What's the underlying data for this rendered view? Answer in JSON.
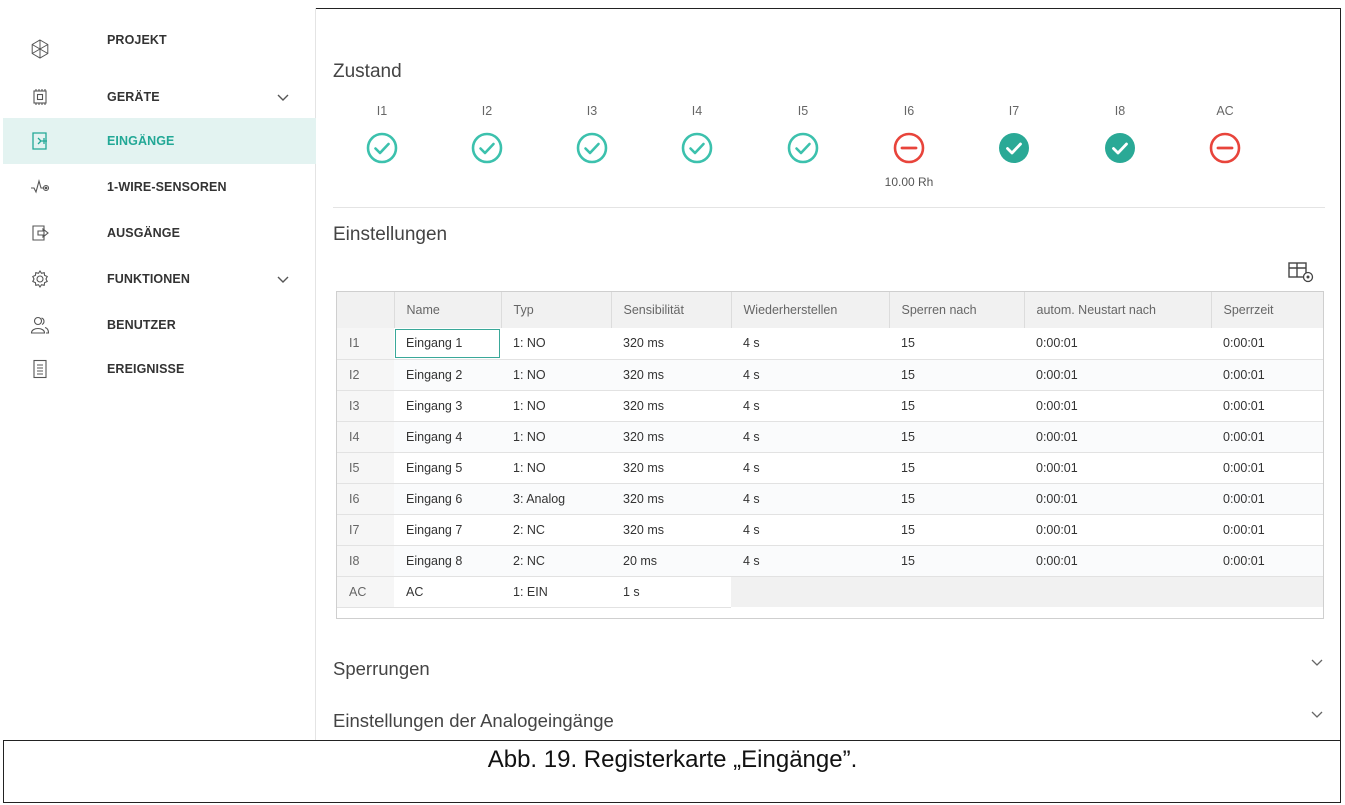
{
  "sidebar": {
    "items": [
      {
        "label": "PROJEKT",
        "icon": "snowflake-icon",
        "expandable": false
      },
      {
        "label": "GERÄTE",
        "icon": "chip-icon",
        "expandable": true
      },
      {
        "label": "EINGÄNGE",
        "icon": "input-icon",
        "expandable": false,
        "active": true
      },
      {
        "label": "1-WIRE-SENSOREN",
        "icon": "sensor-icon",
        "expandable": false
      },
      {
        "label": "AUSGÄNGE",
        "icon": "output-icon",
        "expandable": false
      },
      {
        "label": "FUNKTIONEN",
        "icon": "gear-icon",
        "expandable": true
      },
      {
        "label": "BENUTZER",
        "icon": "users-icon",
        "expandable": false
      },
      {
        "label": "EREIGNISSE",
        "icon": "document-icon",
        "expandable": false
      }
    ]
  },
  "main": {
    "state_title": "Zustand",
    "states": [
      {
        "label": "I1",
        "status": "ok"
      },
      {
        "label": "I2",
        "status": "ok"
      },
      {
        "label": "I3",
        "status": "ok"
      },
      {
        "label": "I4",
        "status": "ok"
      },
      {
        "label": "I5",
        "status": "ok"
      },
      {
        "label": "I6",
        "status": "error",
        "extra": "10.00 Rh"
      },
      {
        "label": "I7",
        "status": "ok-filled"
      },
      {
        "label": "I8",
        "status": "ok-filled"
      },
      {
        "label": "AC",
        "status": "error"
      }
    ],
    "settings_title": "Einstellungen",
    "table": {
      "headers": [
        "",
        "Name",
        "Typ",
        "Sensibilität",
        "Wiederherstellen",
        "Sperren nach",
        "autom. Neustart nach",
        "Sperrzeit"
      ],
      "rows": [
        [
          "I1",
          "Eingang 1",
          "1: NO",
          "320 ms",
          "4 s",
          "15",
          "0:00:01",
          "0:00:01"
        ],
        [
          "I2",
          "Eingang 2",
          "1: NO",
          "320 ms",
          "4 s",
          "15",
          "0:00:01",
          "0:00:01"
        ],
        [
          "I3",
          "Eingang 3",
          "1: NO",
          "320 ms",
          "4 s",
          "15",
          "0:00:01",
          "0:00:01"
        ],
        [
          "I4",
          "Eingang 4",
          "1: NO",
          "320 ms",
          "4 s",
          "15",
          "0:00:01",
          "0:00:01"
        ],
        [
          "I5",
          "Eingang 5",
          "1: NO",
          "320 ms",
          "4 s",
          "15",
          "0:00:01",
          "0:00:01"
        ],
        [
          "I6",
          "Eingang 6",
          "3: Analog",
          "320 ms",
          "4 s",
          "15",
          "0:00:01",
          "0:00:01"
        ],
        [
          "I7",
          "Eingang 7",
          "2: NC",
          "320 ms",
          "4 s",
          "15",
          "0:00:01",
          "0:00:01"
        ],
        [
          "I8",
          "Eingang 8",
          "2: NC",
          "20 ms",
          "4 s",
          "15",
          "0:00:01",
          "0:00:01"
        ],
        [
          "AC",
          "AC",
          "1: EIN",
          "1 s"
        ]
      ]
    },
    "sections": [
      {
        "title": "Sperrungen"
      },
      {
        "title": "Einstellungen der Analogeingänge"
      }
    ]
  },
  "caption": "Abb. 19. Registerkarte „Eingänge”.",
  "colors": {
    "accent": "#22a896",
    "ok_outline": "#3cc1ad",
    "ok_filled": "#2aa996",
    "error": "#e8443b",
    "active_bg": "#e3f3f1"
  }
}
